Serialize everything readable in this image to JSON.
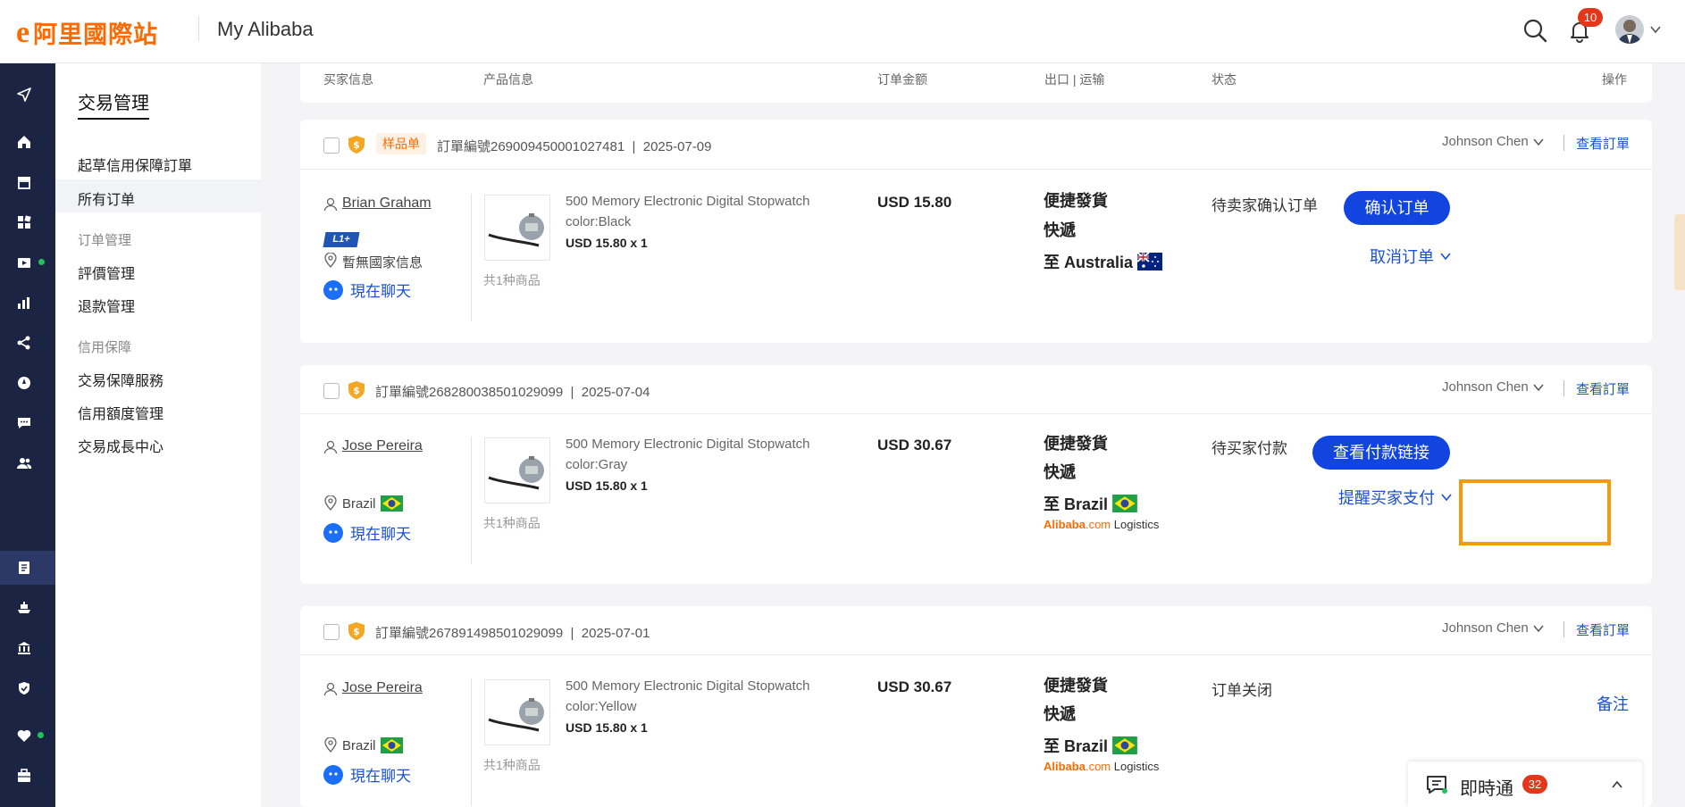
{
  "header": {
    "logo_mark": "e",
    "logo_text": "阿里國際站",
    "title": "My Alibaba",
    "notification_count": "10"
  },
  "sidebar": {
    "title": "交易管理",
    "items": [
      {
        "label": "起草信用保障訂單"
      },
      {
        "label": "所有订单"
      }
    ],
    "group_order": "订单管理",
    "order_items": [
      {
        "label": "評價管理"
      },
      {
        "label": "退款管理"
      }
    ],
    "group_credit": "信用保障",
    "credit_items": [
      {
        "label": "交易保障服務"
      },
      {
        "label": "信用額度管理"
      },
      {
        "label": "交易成長中心"
      }
    ]
  },
  "table_headers": {
    "buyer": "买家信息",
    "product": "产品信息",
    "amount": "订单金额",
    "export": "出口 | 运输",
    "status": "状态",
    "action": "操作"
  },
  "orders": [
    {
      "tag": "样品单",
      "order_no": "訂單編號269009450001027481",
      "date": "2025-07-09",
      "assignee": "Johnson Chen",
      "view_order": "查看訂單",
      "buyer_name": "Brian Graham",
      "buyer_level": "L1+",
      "buyer_location": "暫無國家信息",
      "chat": "現在聊天",
      "product_name": "500 Memory Electronic Digital Stopwatch",
      "product_color": "color:Black",
      "product_price": "USD 15.80 x 1",
      "product_count": "共1种商品",
      "amount": "USD 15.80",
      "ship_line1": "便捷發貨",
      "ship_line2": "快遞",
      "destination": "至 Australia",
      "status": "待卖家确认订单",
      "primary_action": "确认订单",
      "secondary_action": "取消订单"
    },
    {
      "order_no": "訂單編號268280038501029099",
      "date": "2025-07-04",
      "assignee": "Johnson Chen",
      "view_order": "查看訂單",
      "buyer_name": "Jose Pereira",
      "buyer_location": "Brazil",
      "chat": "現在聊天",
      "product_name": "500 Memory Electronic Digital Stopwatch",
      "product_color": "color:Gray",
      "product_price": "USD 15.80 x 1",
      "product_count": "共1种商品",
      "amount": "USD 30.67",
      "ship_line1": "便捷發貨",
      "ship_line2": "快遞",
      "destination": "至 Brazil",
      "logistics_brand": "Alibaba",
      "logistics_domain": ".com",
      "logistics_label": "Logistics",
      "status": "待买家付款",
      "primary_action": "查看付款链接",
      "secondary_action": "提醒买家支付"
    },
    {
      "order_no": "訂單編號267891498501029099",
      "date": "2025-07-01",
      "assignee": "Johnson Chen",
      "view_order": "查看訂單",
      "buyer_name": "Jose Pereira",
      "buyer_location": "Brazil",
      "chat": "現在聊天",
      "product_name": "500 Memory Electronic Digital Stopwatch",
      "product_color": "color:Yellow",
      "product_price": "USD 15.80 x 1",
      "product_count": "共1种商品",
      "amount": "USD 30.67",
      "ship_line1": "便捷發貨",
      "ship_line2": "快遞",
      "destination": "至 Brazil",
      "logistics_brand": "Alibaba",
      "logistics_domain": ".com",
      "logistics_label": "Logistics",
      "status": "订单关闭",
      "secondary_action": "备注"
    }
  ],
  "im": {
    "label": "即時通",
    "count": "32"
  },
  "colors": {
    "brand": "#ff6a00",
    "primary": "#1244e0",
    "link": "#1a4fd6",
    "rail": "#1b2442",
    "highlight": "#f59a0a"
  }
}
